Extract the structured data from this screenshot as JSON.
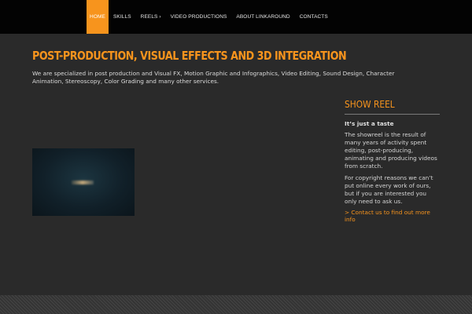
{
  "nav": {
    "items": [
      {
        "label": "HOME",
        "active": true
      },
      {
        "label": "SKILLS"
      },
      {
        "label": "REELS ›"
      },
      {
        "label": "VIDEO PRODUCTIONS"
      },
      {
        "label": "ABOUT LINKAROUND"
      },
      {
        "label": "CONTACTS"
      }
    ]
  },
  "main": {
    "title": "POST-PRODUCTION, VISUAL EFFECTS AND 3D INTEGRATION",
    "intro": "We are specialized in post production and Visual FX, Motion Graphic and Infographics, Video Editing, Sound Design, Character Animation, Stereoscopy, Color Grading and many other services."
  },
  "sidebar": {
    "title": "SHOW REEL",
    "subtitle": "It’s just a taste",
    "p1": "The showreel is the result of many years of activity spent editing, post-producing, animating and producing videos from scratch.",
    "p2": "For copyright reasons we can’t put online every work of ours, but if you are interested you only need to ask us.",
    "link": "> Contact us to find out more info"
  },
  "colors": {
    "accent": "#f7941d",
    "topbar": "#030303",
    "background": "#2a2a2a"
  }
}
